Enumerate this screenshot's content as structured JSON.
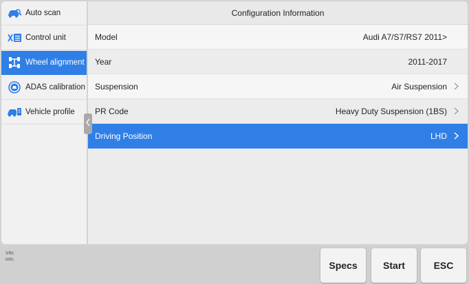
{
  "sidebar": {
    "items": [
      {
        "label": "Auto scan",
        "icon": "car-scan-icon"
      },
      {
        "label": "Control unit",
        "icon": "control-unit-icon"
      },
      {
        "label": "Wheel alignment",
        "icon": "wheel-alignment-icon",
        "active": true
      },
      {
        "label": "ADAS calibration",
        "icon": "adas-calibration-icon"
      },
      {
        "label": "Vehicle profile",
        "icon": "vehicle-profile-icon"
      }
    ]
  },
  "main": {
    "title": "Configuration Information",
    "rows": [
      {
        "label": "Model",
        "value": "Audi A7/S7/RS7 2011>",
        "chevron": false
      },
      {
        "label": "Year",
        "value": "2011-2017",
        "chevron": false
      },
      {
        "label": "Suspension",
        "value": "Air Suspension",
        "chevron": true
      },
      {
        "label": "PR Code",
        "value": "Heavy Duty Suspension (1BS)",
        "chevron": true
      },
      {
        "label": "Driving Position",
        "value": "LHD",
        "chevron": true,
        "selected": true
      }
    ]
  },
  "footer": {
    "vin_label": "VIN:",
    "info_label": "Info:",
    "specs_label": "Specs",
    "start_label": "Start",
    "esc_label": "ESC"
  },
  "colors": {
    "accent": "#2f7fe6",
    "background": "#d3d3d3"
  }
}
